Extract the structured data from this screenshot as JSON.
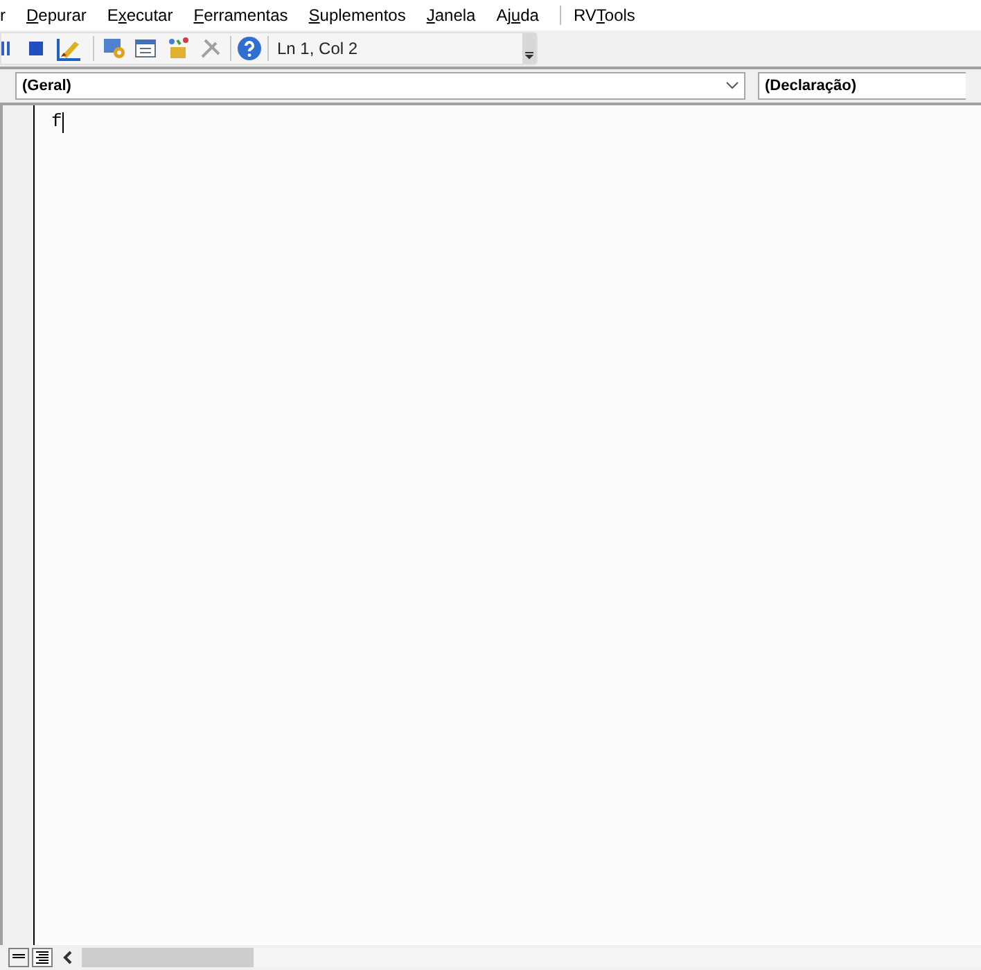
{
  "menu_bar": {
    "items": [
      {
        "pre": "r"
      },
      {
        "key": "D",
        "post": "epurar"
      },
      {
        "pre": "E",
        "key": "x",
        "post": "ecutar"
      },
      {
        "key": "F",
        "post": "erramentas"
      },
      {
        "key": "S",
        "post": "uplementos"
      },
      {
        "key": "J",
        "post": "anela"
      },
      {
        "pre": "Aj",
        "key": "u",
        "post": "da"
      },
      {
        "pre": "RV",
        "key": "T",
        "post": "ools"
      }
    ]
  },
  "toolbar": {
    "position": "Ln 1, Col 2"
  },
  "code_window": {
    "object_box": "(Geral)",
    "procedure_box": "(Declaração)",
    "code_lines": [
      "f"
    ]
  }
}
